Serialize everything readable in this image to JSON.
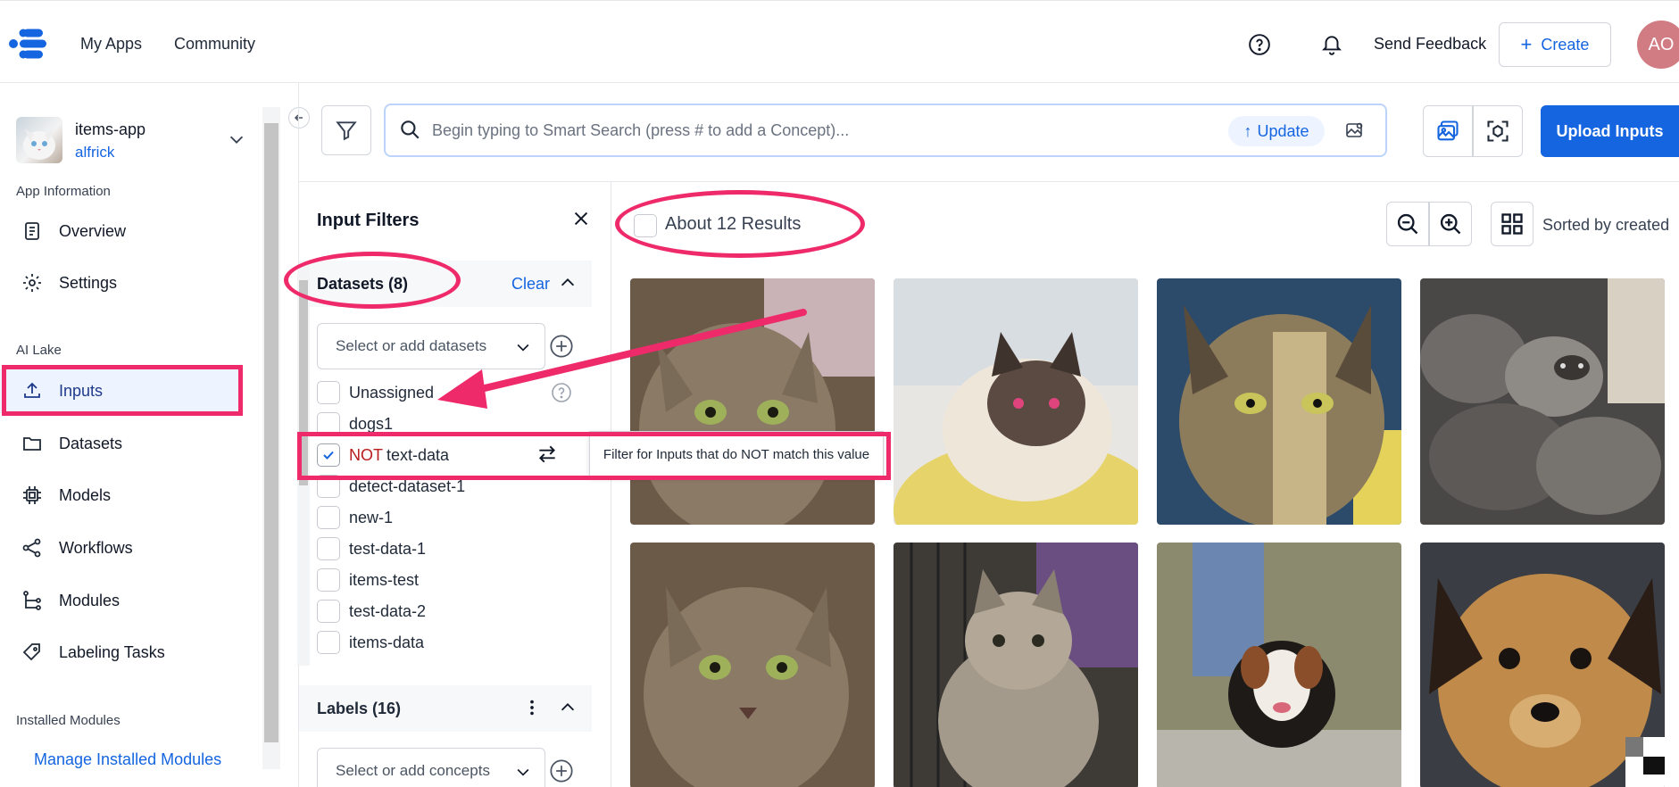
{
  "nav": {
    "my_apps": "My Apps",
    "community": "Community",
    "send_feedback": "Send Feedback",
    "create": "Create",
    "avatar_initials": "AO"
  },
  "sidebar": {
    "app_name": "items-app",
    "app_user": "alfrick",
    "section_app_info": "App Information",
    "overview": "Overview",
    "settings": "Settings",
    "section_ai_lake": "AI Lake",
    "inputs": "Inputs",
    "datasets": "Datasets",
    "models": "Models",
    "workflows": "Workflows",
    "modules": "Modules",
    "labeling_tasks": "Labeling Tasks",
    "section_installed": "Installed Modules",
    "manage_installed": "Manage Installed Modules"
  },
  "search": {
    "placeholder": "Begin typing to Smart Search (press # to add a Concept)...",
    "update": "Update"
  },
  "toolbar": {
    "upload": "Upload Inputs"
  },
  "filters": {
    "title": "Input Filters",
    "datasets_title": "Datasets (8)",
    "clear": "Clear",
    "select_datasets": "Select or add datasets",
    "rows": [
      {
        "label": "Unassigned",
        "checked": false
      },
      {
        "label": "dogs1",
        "checked": false
      },
      {
        "label": "text-data",
        "checked": true,
        "prefix": "NOT"
      },
      {
        "label": "detect-dataset-1",
        "checked": false
      },
      {
        "label": "new-1",
        "checked": false
      },
      {
        "label": "test-data-1",
        "checked": false
      },
      {
        "label": "items-test",
        "checked": false
      },
      {
        "label": "test-data-2",
        "checked": false
      },
      {
        "label": "items-data",
        "checked": false
      }
    ],
    "labels_title": "Labels (16)",
    "select_concepts": "Select or add concepts",
    "tooltip": "Filter for Inputs that do NOT match this value"
  },
  "results": {
    "count": "About 12 Results",
    "sorted": "Sorted by created"
  },
  "colors": {
    "accent": "#1565e0",
    "annotation": "#ef2a6b",
    "not_red": "#b91c1c"
  }
}
